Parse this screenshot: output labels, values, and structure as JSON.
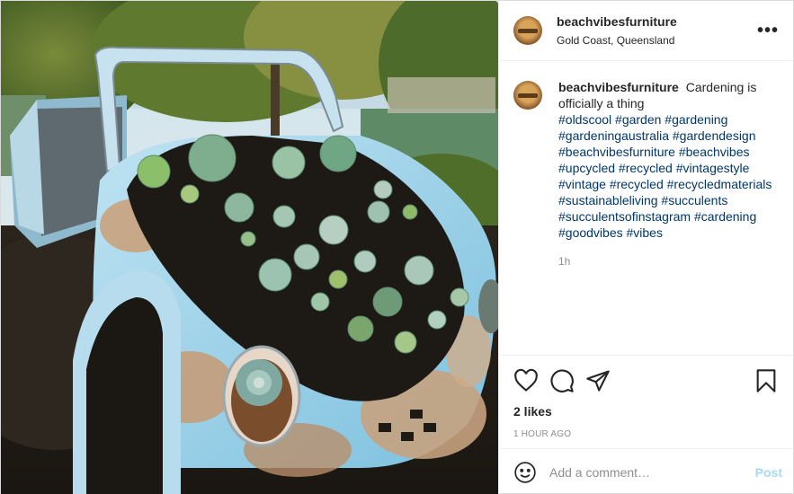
{
  "post": {
    "username": "beachvibesfurniture",
    "location": "Gold Coast, Queensland",
    "more_label": "•••",
    "caption_text": "Cardening is officially a thing",
    "hashtags": "#oldscool #garden #gardening #gardeningaustralia #gardendesign #beachvibesfurniture #beachvibes #upcycled #recycled #vintagestyle #vintage #recycled #recycledmaterials #sustainableliving #succulents #succulentsofinstagram #cardening #goodvibes #vibes",
    "time_ago": "1h",
    "likes": "2 likes",
    "date": "1 HOUR AGO"
  },
  "comment_box": {
    "placeholder": "Add a comment…",
    "post_label": "Post"
  },
  "icons": {
    "like": "heart-icon",
    "comment": "speech-bubble-icon",
    "share": "paper-plane-icon",
    "save": "bookmark-icon",
    "emoji": "smiley-icon"
  },
  "colors": {
    "link": "#00376b",
    "post_button": "#0095f6",
    "muted": "#8e8e8e"
  }
}
